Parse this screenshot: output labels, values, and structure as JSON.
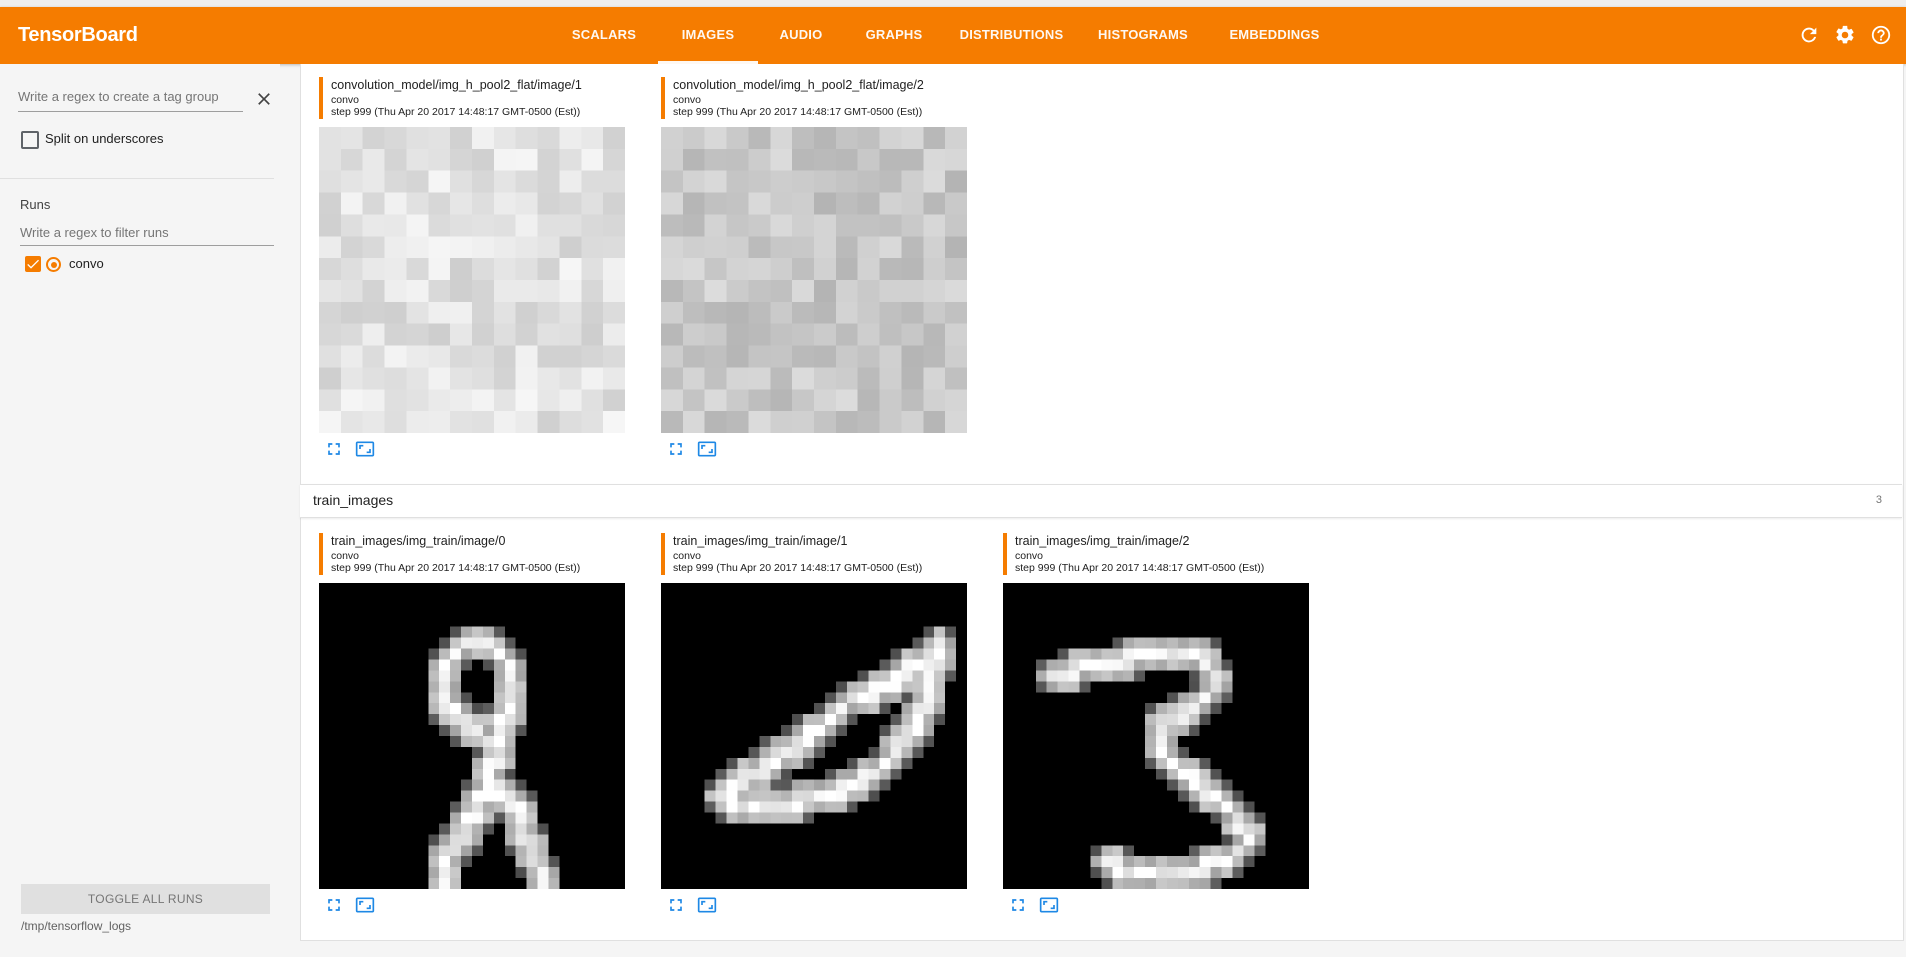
{
  "app": {
    "title": "TensorBoard",
    "accent_color": "#f57c00"
  },
  "tabs": [
    {
      "label": "SCALARS",
      "active": false
    },
    {
      "label": "IMAGES",
      "active": true
    },
    {
      "label": "AUDIO",
      "active": false
    },
    {
      "label": "GRAPHS",
      "active": false
    },
    {
      "label": "DISTRIBUTIONS",
      "active": false
    },
    {
      "label": "HISTOGRAMS",
      "active": false
    },
    {
      "label": "EMBEDDINGS",
      "active": false
    }
  ],
  "header_icons": [
    "refresh-icon",
    "settings-gear-icon",
    "help-icon"
  ],
  "sidebar": {
    "tag_group_placeholder": "Write a regex to create a tag group",
    "split_on_underscores_label": "Split on underscores",
    "split_on_underscores_checked": false,
    "runs_title": "Runs",
    "runs_filter_placeholder": "Write a regex to filter runs",
    "runs": [
      {
        "name": "convo",
        "checked": true,
        "color": "#f57c00"
      }
    ],
    "toggle_all_label": "TOGGLE ALL RUNS",
    "log_dir": "/tmp/tensorflow_logs"
  },
  "sections": [
    {
      "cards": [
        {
          "tag": "convolution_model/img_h_pool2_flat/image/1",
          "run": "convo",
          "step": "step 999 (Thu Apr 20 2017 14:48:17 GMT-0500 (Est))"
        },
        {
          "tag": "convolution_model/img_h_pool2_flat/image/2",
          "run": "convo",
          "step": "step 999 (Thu Apr 20 2017 14:48:17 GMT-0500 (Est))"
        }
      ]
    },
    {
      "title": "train_images",
      "count": "3",
      "cards": [
        {
          "tag": "train_images/img_train/image/0",
          "run": "convo",
          "step": "step 999 (Thu Apr 20 2017 14:48:17 GMT-0500 (Est))"
        },
        {
          "tag": "train_images/img_train/image/1",
          "run": "convo",
          "step": "step 999 (Thu Apr 20 2017 14:48:17 GMT-0500 (Est))"
        },
        {
          "tag": "train_images/img_train/image/2",
          "run": "convo",
          "step": "step 999 (Thu Apr 20 2017 14:48:17 GMT-0500 (Est))"
        }
      ]
    }
  ]
}
